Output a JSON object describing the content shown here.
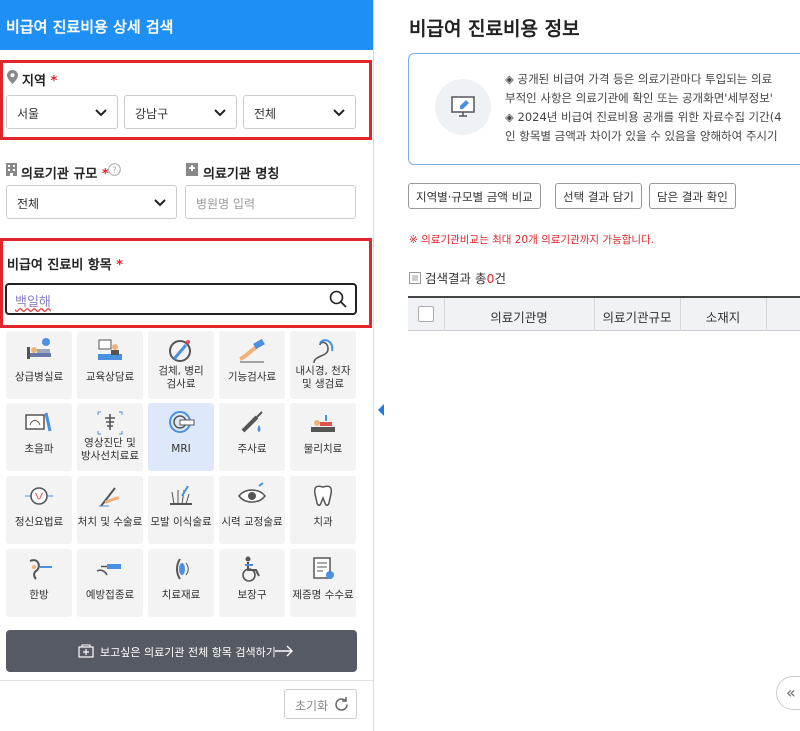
{
  "left_panel": {
    "title": "비급여 진료비용 상세 검색",
    "region": {
      "label": "지역",
      "required_mark": "*",
      "city": "서울",
      "district": "강남구",
      "dong": "전체"
    },
    "facility_size": {
      "label": "의료기관 규모",
      "required_mark": "*",
      "value": "전체"
    },
    "facility_name": {
      "label": "의료기관 명칭",
      "placeholder": "병원명 입력"
    },
    "items": {
      "label": "비급여 진료비 항목",
      "required_mark": "*",
      "search_value": "백일해"
    },
    "categories": [
      {
        "label": "상급병실료",
        "icon": "hospital-bed-icon"
      },
      {
        "label": "교육상담료",
        "icon": "counseling-icon"
      },
      {
        "label": "검체, 병리\n검사료",
        "icon": "specimen-icon"
      },
      {
        "label": "기능검사료",
        "icon": "function-test-icon"
      },
      {
        "label": "내시경, 천자\n및 생검료",
        "icon": "endoscope-icon"
      },
      {
        "label": "초음파",
        "icon": "ultrasound-icon"
      },
      {
        "label": "영상진단 및\n방사선치료료",
        "icon": "xray-icon"
      },
      {
        "label": "MRI",
        "icon": "mri-icon",
        "active": true
      },
      {
        "label": "주사료",
        "icon": "syringe-icon"
      },
      {
        "label": "물리치료",
        "icon": "physical-therapy-icon"
      },
      {
        "label": "정신요법료",
        "icon": "brain-icon"
      },
      {
        "label": "처치 및 수술료",
        "icon": "surgery-icon"
      },
      {
        "label": "모발 이식술료",
        "icon": "hair-icon"
      },
      {
        "label": "시력 교정술료",
        "icon": "eye-icon"
      },
      {
        "label": "치과",
        "icon": "tooth-icon"
      },
      {
        "label": "한방",
        "icon": "acupuncture-icon"
      },
      {
        "label": "예방접종료",
        "icon": "vaccine-icon"
      },
      {
        "label": "치료재료",
        "icon": "material-icon"
      },
      {
        "label": "보장구",
        "icon": "wheelchair-icon"
      },
      {
        "label": "제증명 수수료",
        "icon": "certificate-icon"
      }
    ],
    "search_all_button": "보고싶은 의료기관 전체 항목 검색하기",
    "reset_button": "초기화"
  },
  "right_panel": {
    "title": "비급여 진료비용 정보",
    "notice_lines": [
      "◈ 공개된 비급여 가격 등은 의료기관마다 투입되는 의료",
      "부적인 사항은 의료기관에 확인 또는 공개화면'세부정보'",
      "◈ 2024년 비급여 진료비용 공개를 위한 자료수집 기간(4",
      "인 항목별 금액과 차이가 있을 수 있음을 양해하여 주시기"
    ],
    "buttons": [
      "지역별·규모별 금액 비교",
      "선택 결과 담기",
      "담은 결과 확인"
    ],
    "warning": "※ 의료기관비교는 최대 20개 의료기관까지 가능합니다.",
    "result_prefix": "검색결과 총",
    "result_count": "0",
    "result_suffix": "건",
    "table_headers": [
      "의료기관명",
      "의료기관규모",
      "소재지"
    ],
    "collapse_glyph": "«"
  },
  "colors": {
    "header_blue": "#1e90f5",
    "highlight_red": "#e0262b",
    "dark_button": "#555a63"
  }
}
